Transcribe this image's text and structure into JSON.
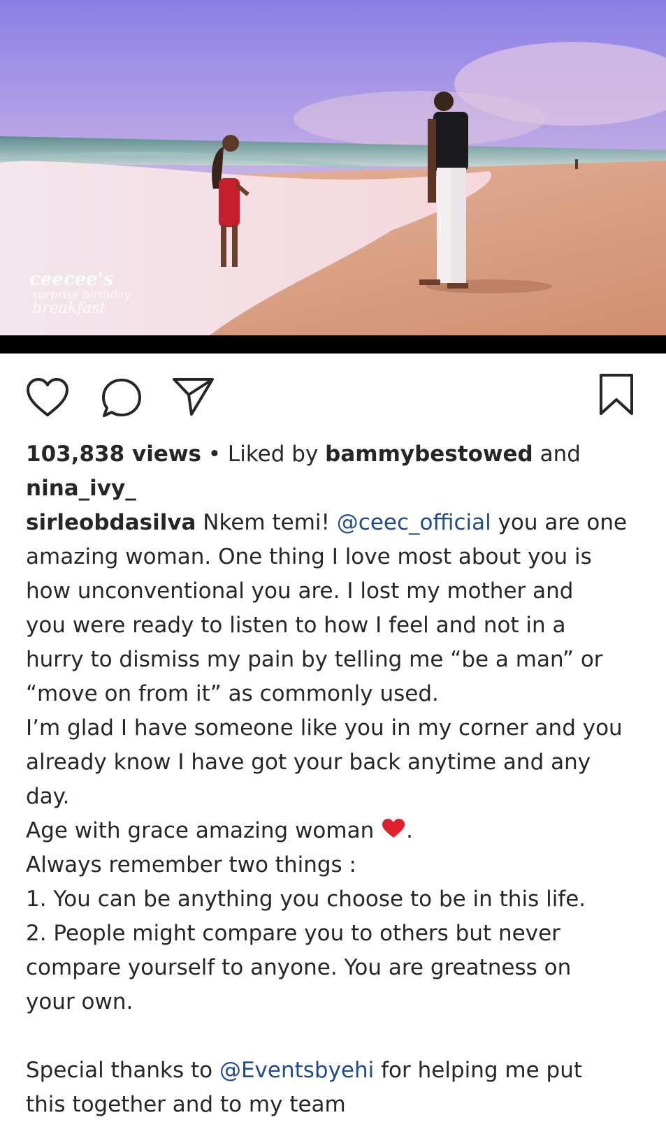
{
  "media": {
    "watermark_line1": "ceecee's",
    "watermark_line2": "surprise birthday",
    "watermark_line3": "breakfast"
  },
  "actions": {
    "like_icon": "heart-outline-icon",
    "comment_icon": "speech-bubble-icon",
    "share_icon": "paper-plane-icon",
    "save_icon": "bookmark-icon"
  },
  "stats": {
    "views": "103,838 views",
    "separator": " • Liked by ",
    "liker1": "bammybestowed",
    "and": " and",
    "liker2": "nina_ivy_"
  },
  "caption": {
    "username": "sirleobdasilva",
    "l1_a": " Nkem temi! ",
    "mention1": "@ceec_official",
    "l1_b": " you are one",
    "l2": "amazing woman. One thing I love most about you is",
    "l3": "how unconventional you are. I lost my mother and",
    "l4": "you were ready to listen to how I feel and not in a",
    "l5": "hurry to dismiss my pain by telling me “be a man” or",
    "l6": "“move on from it” as commonly used.",
    "l7": "I’m glad I have someone like you in my corner and you",
    "l8": "already know I have got your back anytime and any",
    "l9": "day.",
    "l10": "Age with grace amazing woman ",
    "l10_end": ".",
    "l11": "Always remember two things :",
    "l12": "1. You can be anything you choose to be in this life.",
    "l13": "2. People might compare you to others but never",
    "l14": "compare yourself to anyone. You are greatness on",
    "l15": "your own.",
    "l16_a": "Special thanks to ",
    "mention2": "@Eventsbyehi",
    "l16_b": " for helping me put",
    "l17": "this together and to my team"
  },
  "colors": {
    "text": "#262626",
    "mention": "#1f4d8c",
    "heart": "#e0202e"
  }
}
